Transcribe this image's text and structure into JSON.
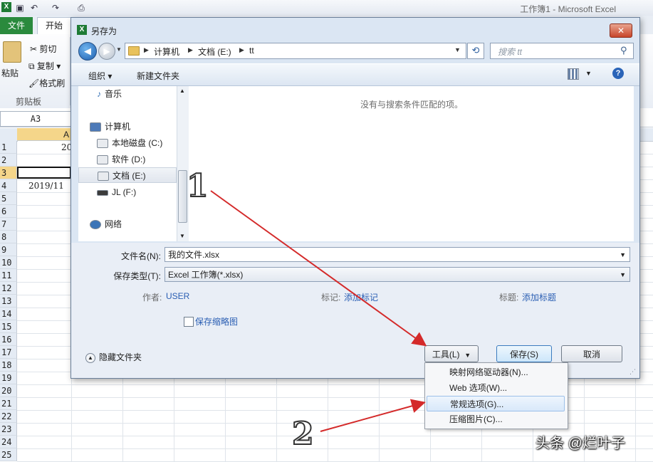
{
  "excel": {
    "title": "工作簿1 - Microsoft Excel",
    "tabs": {
      "file": "文件",
      "home": "开始"
    },
    "clipboard": {
      "paste": "粘贴",
      "cut": "剪切",
      "copy": "复制",
      "format_painter": "格式刷",
      "group_label": "剪贴板"
    },
    "name_box": "A3",
    "column_a": "A",
    "rows": [
      "1",
      "2",
      "3",
      "4",
      "5",
      "6",
      "7",
      "8",
      "9",
      "10",
      "11",
      "12",
      "13",
      "14",
      "15",
      "16",
      "17",
      "18",
      "19",
      "20",
      "21",
      "22",
      "23",
      "24",
      "25"
    ],
    "cells": {
      "a1": "20",
      "a4": "2019/11"
    }
  },
  "dialog": {
    "title": "另存为",
    "close_symbol": "✕",
    "breadcrumb": [
      "计算机",
      "文档 (E:)",
      "tt"
    ],
    "search_placeholder": "搜索 tt",
    "toolbar": {
      "organize": "组织 ▾",
      "new_folder": "新建文件夹"
    },
    "nav_items": [
      "音乐",
      "计算机",
      "本地磁盘 (C:)",
      "软件 (D:)",
      "文档 (E:)",
      "JL (F:)",
      "网络"
    ],
    "empty_message": "没有与搜索条件匹配的项。",
    "filename_label": "文件名(N):",
    "filename_value": "我的文件.xlsx",
    "filetype_label": "保存类型(T):",
    "filetype_value": "Excel 工作簿(*.xlsx)",
    "author_label": "作者:",
    "author_value": "USER",
    "tags_label": "标记:",
    "tags_value": "添加标记",
    "title_label": "标题:",
    "title_value": "添加标题",
    "thumbnail_label": "保存缩略图",
    "hide_folders": "隐藏文件夹",
    "tools_button": "工具(L)",
    "save_button": "保存(S)",
    "cancel_button": "取消"
  },
  "tools_menu": [
    "映射网络驱动器(N)...",
    "Web 选项(W)...",
    "常规选项(G)...",
    "压缩图片(C)..."
  ],
  "annotations": {
    "step1": "1",
    "step2": "2",
    "arrow_color": "#d42a2a"
  },
  "watermark": "头条 @烂叶子"
}
